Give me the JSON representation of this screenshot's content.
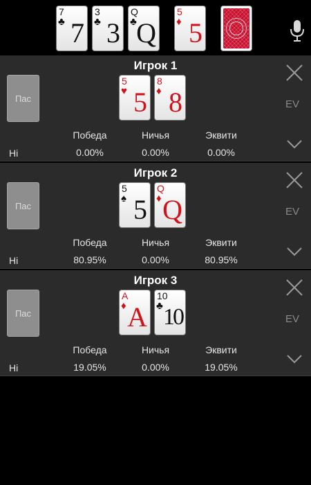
{
  "board": {
    "cards": [
      {
        "rank": "7",
        "suit": "♣",
        "color": "black"
      },
      {
        "rank": "3",
        "suit": "♣",
        "color": "black"
      },
      {
        "rank": "Q",
        "suit": "♣",
        "color": "black"
      },
      {
        "rank": "5",
        "suit": "♦",
        "color": "red"
      }
    ],
    "mic_icon": "microphone-icon",
    "back_card": "card-back"
  },
  "players": [
    {
      "title": "Игрок 1",
      "fold_label": "Пас",
      "ev_label": "EV",
      "range_label": "Hi",
      "cards": [
        {
          "rank": "5",
          "suit": "♥",
          "color": "red"
        },
        {
          "rank": "8",
          "suit": "♦",
          "color": "red"
        }
      ],
      "headers": {
        "win": "Победа",
        "tie": "Ничья",
        "equity": "Эквити"
      },
      "values": {
        "win": "0.00%",
        "tie": "0.00%",
        "equity": "0.00%"
      }
    },
    {
      "title": "Игрок 2",
      "fold_label": "Пас",
      "ev_label": "EV",
      "range_label": "Hi",
      "cards": [
        {
          "rank": "5",
          "suit": "♠",
          "color": "black"
        },
        {
          "rank": "Q",
          "suit": "♦",
          "color": "red"
        }
      ],
      "headers": {
        "win": "Победа",
        "tie": "Ничья",
        "equity": "Эквити"
      },
      "values": {
        "win": "80.95%",
        "tie": "0.00%",
        "equity": "80.95%"
      }
    },
    {
      "title": "Игрок 3",
      "fold_label": "Пас",
      "ev_label": "EV",
      "range_label": "Hi",
      "cards": [
        {
          "rank": "A",
          "suit": "♦",
          "color": "red"
        },
        {
          "rank": "10",
          "suit": "♣",
          "color": "black"
        }
      ],
      "headers": {
        "win": "Победа",
        "tie": "Ничья",
        "equity": "Эквити"
      },
      "values": {
        "win": "19.05%",
        "tie": "0.00%",
        "equity": "19.05%"
      }
    }
  ],
  "colors": {
    "background": "#000000",
    "panel": "#2b2b2b",
    "red_suit": "#d0121b",
    "card_back": "#c8102e"
  }
}
